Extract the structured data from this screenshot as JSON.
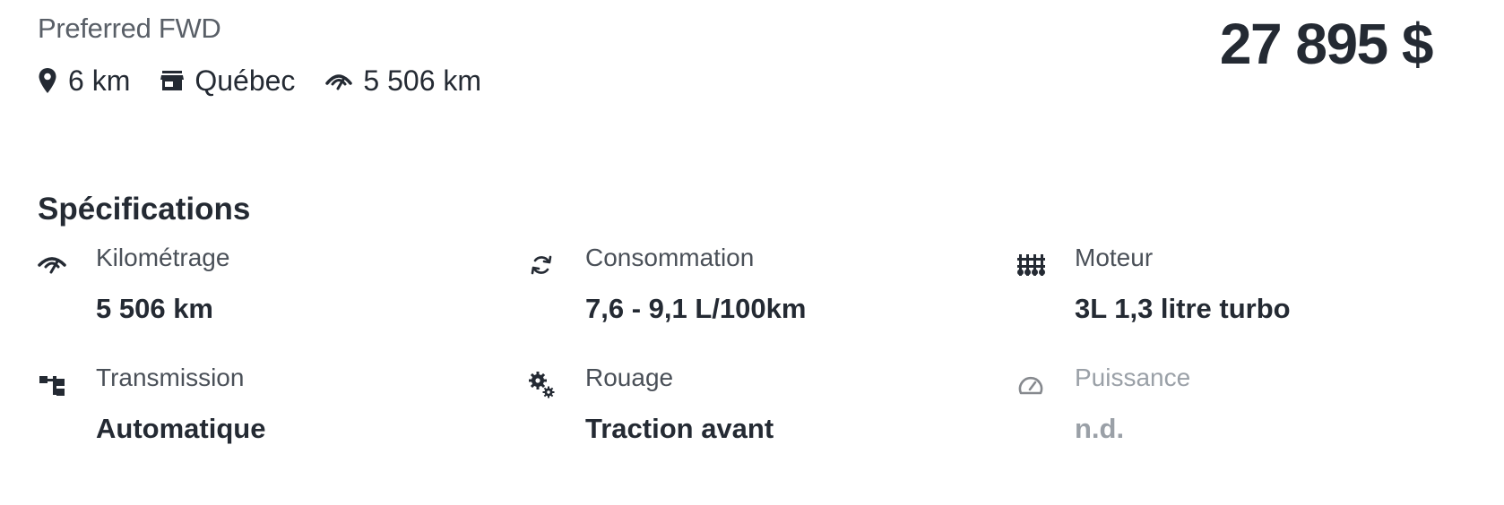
{
  "listing": {
    "subtitle": "Preferred FWD",
    "distance": "6 km",
    "city": "Québec",
    "mileage": "5 506 km",
    "price": "27 895 $"
  },
  "specifications": {
    "title": "Spécifications",
    "items": [
      {
        "label": "Kilométrage",
        "value": "5 506 km",
        "icon": "odometer-icon"
      },
      {
        "label": "Consommation",
        "value": "7,6 - 9,1 L/100km",
        "icon": "refresh-cycle-icon"
      },
      {
        "label": "Moteur",
        "value": "3L 1,3 litre turbo",
        "icon": "engine-cylinders-icon"
      },
      {
        "label": "Transmission",
        "value": "Automatique",
        "icon": "transmission-icon"
      },
      {
        "label": "Rouage",
        "value": "Traction avant",
        "icon": "gears-icon"
      },
      {
        "label": "Puissance",
        "value": "n.d.",
        "icon": "gauge-icon"
      }
    ]
  }
}
